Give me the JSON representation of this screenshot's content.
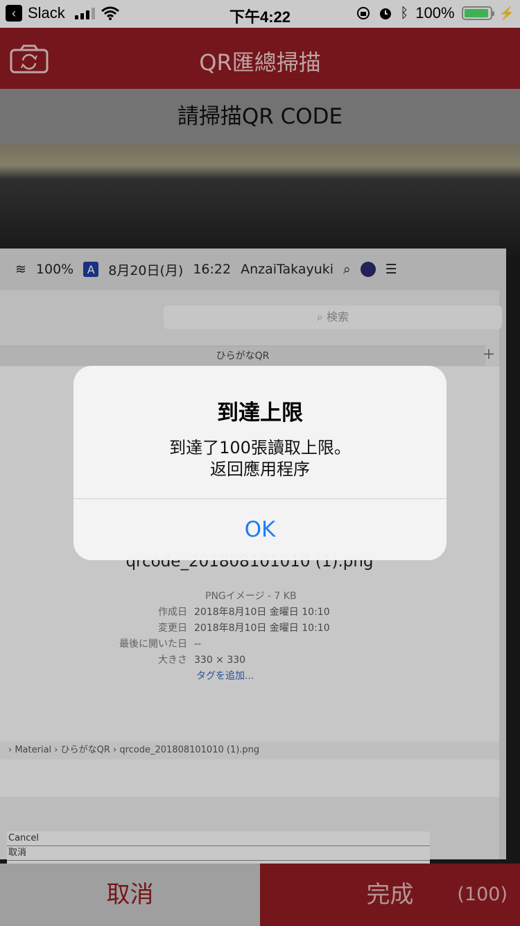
{
  "status_bar": {
    "back_app": "Slack",
    "time": "下午4:22",
    "battery": "100%"
  },
  "nav": {
    "title": "QR匯總掃描"
  },
  "subheader": "請掃描QR CODE",
  "camera_view": {
    "menubar": {
      "battery": "100%",
      "input_source": "A",
      "date": "8月20日(月)",
      "time": "16:22",
      "user": "AnzaiTakayuki"
    },
    "search_placeholder": "検索",
    "tab_title": "ひらがなQR",
    "tab_plus": "+",
    "filename": "qrcode_201808101010 (1).png",
    "file_type": "PNGイメージ - 7 KB",
    "meta": [
      {
        "key": "作成日",
        "value": "2018年8月10日 金曜日 10:10"
      },
      {
        "key": "変更日",
        "value": "2018年8月10日 金曜日 10:10"
      },
      {
        "key": "最後に開いた日",
        "value": "--"
      },
      {
        "key": "大きさ",
        "value": "330 × 330"
      }
    ],
    "add_tag": "タグを追加...",
    "path": "› Material › ひらがなQR › qrcode_201808101010 (1).png",
    "paper_lines": [
      "Cancel",
      "取消",
      ""
    ]
  },
  "alert": {
    "title": "到達上限",
    "message_line1": "到達了100張讀取上限。",
    "message_line2": "返回應用程序",
    "ok": "OK"
  },
  "bottom": {
    "cancel": "取消",
    "done": "完成",
    "count": "(100)"
  },
  "colors": {
    "brand": "#8e1b22",
    "alert_button": "#1e7cf5"
  }
}
